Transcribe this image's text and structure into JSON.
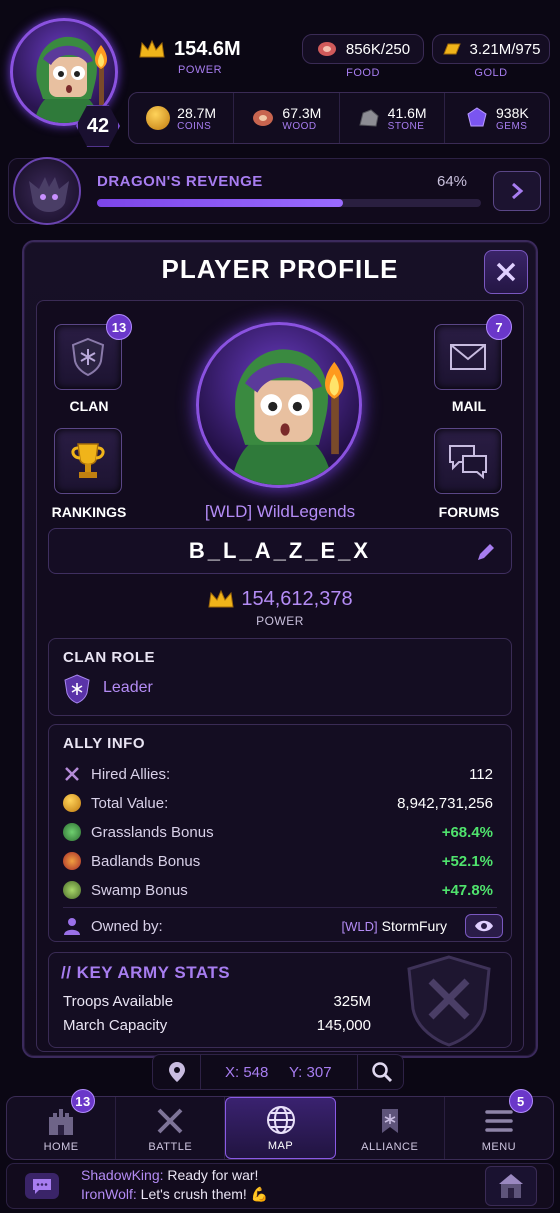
{
  "player": {
    "level": "42"
  },
  "power": {
    "value": "154.6M",
    "label": "POWER"
  },
  "food": {
    "value": "856K/250",
    "label": "FOOD"
  },
  "gold": {
    "value": "3.21M/975",
    "label": "GOLD"
  },
  "resources": [
    {
      "value": "28.7M",
      "label": "COINS",
      "icon": "coin-icon",
      "color": "#e6a52a"
    },
    {
      "value": "67.3M",
      "label": "WOOD",
      "icon": "wood-icon",
      "color": "#d06a5a"
    },
    {
      "value": "41.6M",
      "label": "STONE",
      "icon": "stone-icon",
      "color": "#9a9aa0"
    },
    {
      "value": "938K",
      "label": "GEMS",
      "icon": "gem-icon",
      "color": "#7a55f0"
    }
  ],
  "quest": {
    "title": "DRAGON'S REVENGE",
    "percent_label": "64%",
    "progress": 0.64
  },
  "profile": {
    "title": "PLAYER PROFILE",
    "clan_label": "CLAN",
    "clan_badge": "13",
    "mail_label": "MAIL",
    "mail_badge": "7",
    "rankings_label": "RANKINGS",
    "forums_label": "FORUMS",
    "tag_name": "[WLD] WildLegends",
    "player_name": "B_L_A_Z_E_X",
    "power_value": "154,612,378",
    "power_label": "POWER"
  },
  "clan_role": {
    "title": "CLAN ROLE",
    "role": "Leader"
  },
  "ally_info": {
    "title": "ALLY INFO",
    "rows": [
      {
        "label": "Hired Allies:",
        "value": "112",
        "icon": "allies-icon",
        "color": "#b58bd8",
        "green": false
      },
      {
        "label": "Total Value:",
        "value": "8,942,731,256",
        "icon": "coin-icon",
        "color": "#e6a52a",
        "green": false
      },
      {
        "label": "Grasslands Bonus",
        "value": "+68.4%",
        "icon": "grass-icon",
        "color": "#3e8f45",
        "green": true
      },
      {
        "label": "Badlands Bonus",
        "value": "+52.1%",
        "icon": "badlands-icon",
        "color": "#c23a35",
        "green": true
      },
      {
        "label": "Swamp Bonus",
        "value": "+47.8%",
        "icon": "swamp-icon",
        "color": "#6fa04a",
        "green": true
      }
    ],
    "owned_label": "Owned by:",
    "owner_tag": "[WLD]",
    "owner_name": "StormFury"
  },
  "army": {
    "title": "// KEY ARMY STATS",
    "troops_label": "Troops Available",
    "troops_value": "325M",
    "march_label": "March Capacity",
    "march_value": "145,000"
  },
  "coords": {
    "x_label": "X: 548",
    "y_label": "Y: 307"
  },
  "nav": {
    "home": "HOME",
    "home_badge": "13",
    "battle": "BATTLE",
    "map": "MAP",
    "alliance": "ALLIANCE",
    "menu": "MENU",
    "menu_badge": "5"
  },
  "chat": {
    "messages": [
      {
        "user": "ShadowKing:",
        "text": "Ready for war!"
      },
      {
        "user": "IronWolf:",
        "text": "Let's crush them! 💪"
      }
    ]
  },
  "colors": {
    "accent": "#8a52e0",
    "label_purple": "#a77df0",
    "green": "#4fe36d",
    "gold": "#f0b41a"
  }
}
